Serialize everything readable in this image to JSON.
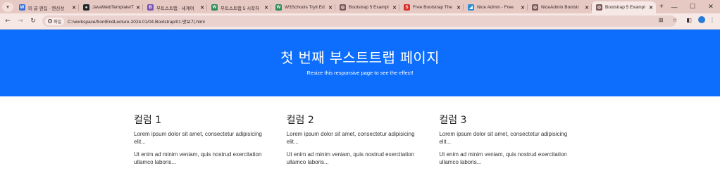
{
  "tabstrip": {
    "tabs": [
      {
        "title": "미 글 편집 · 멘션성",
        "icon_color": "#3b6fd4",
        "icon_glyph": "W"
      },
      {
        "title": "JavaWebTemplate/T",
        "icon_color": "#24292e",
        "icon_glyph": "●"
      },
      {
        "title": "부트스트랩 · 세계여",
        "icon_color": "#7952b3",
        "icon_glyph": "B"
      },
      {
        "title": "부트스트랩 5 시작하",
        "icon_color": "#2e8b57",
        "icon_glyph": "W"
      },
      {
        "title": "W3Schools Tryit Ed",
        "icon_color": "#2e8b57",
        "icon_glyph": "W"
      },
      {
        "title": "Bootstrap 5 Exampl",
        "icon_color": "#7a5a58",
        "icon_glyph": "◎"
      },
      {
        "title": "Free Bootstrap The",
        "icon_color": "#d9302a",
        "icon_glyph": "S"
      },
      {
        "title": "Nice Admin - Free",
        "icon_color": "#2b8fd6",
        "icon_glyph": "◢"
      },
      {
        "title": "NiceAdmin Bootstr",
        "icon_color": "#7a5a58",
        "icon_glyph": "◎"
      },
      {
        "title": "Bootstrap 5 Exampl",
        "icon_color": "#7a5a58",
        "icon_glyph": "◎",
        "active": true
      }
    ],
    "new_tab": "+",
    "close_glyph": "✕",
    "window": {
      "minimize": "—",
      "maximize": "☐",
      "close": "✕"
    }
  },
  "toolbar": {
    "site_chip": "파일",
    "url": "C:/workspace/frontEndLecture-2024.01/04.Bootstrap/01.맛보기.html"
  },
  "hero": {
    "title": "첫 번째 부스트트랩 페이지",
    "subtitle": "Resize this responsive page to see the effect!"
  },
  "columns": [
    {
      "heading": "컬럼 1",
      "p1": "Lorem ipsum dolor sit amet, consectetur adipisicing elit...",
      "p2": "Ut enim ad minim veniam, quis nostrud exercitation ullamco laboris..."
    },
    {
      "heading": "컬럼 2",
      "p1": "Lorem ipsum dolor sit amet, consectetur adipisicing elit...",
      "p2": "Ut enim ad minim veniam, quis nostrud exercitation ullamco laboris..."
    },
    {
      "heading": "컬럼 3",
      "p1": "Lorem ipsum dolor sit amet, consectetur adipisicing elit...",
      "p2": "Ut enim ad minim veniam, quis nostrud exercitation ullamco laboris..."
    }
  ],
  "colors": {
    "hero_bg": "#0d6efd",
    "tabstrip_bg": "#e7c9c4",
    "toolbar_bg": "#f6e8e5"
  }
}
